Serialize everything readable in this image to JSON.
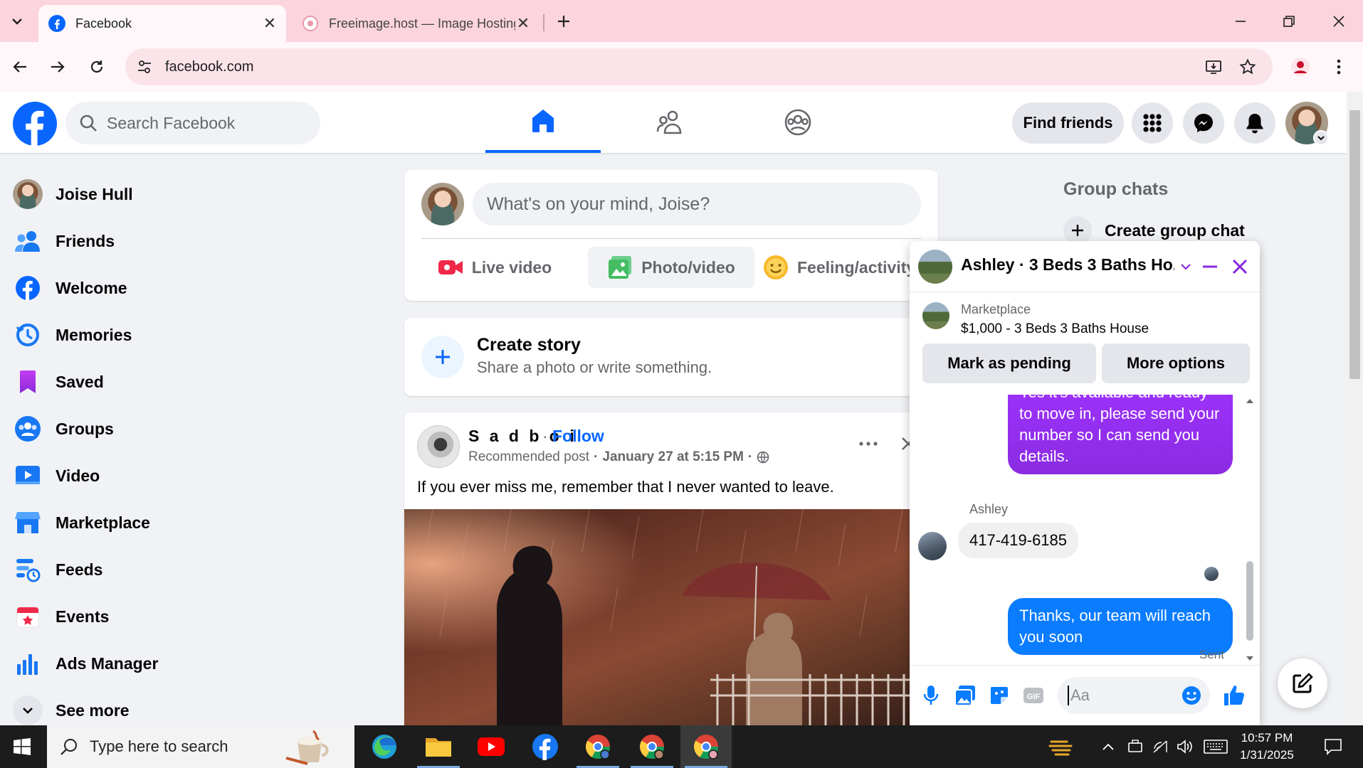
{
  "browser": {
    "tabs": [
      {
        "title": "Facebook",
        "active": true
      },
      {
        "title": "Freeimage.host — Image Hosting",
        "active": false
      }
    ],
    "url": "facebook.com"
  },
  "fb": {
    "search_placeholder": "Search Facebook",
    "find_friends": "Find friends",
    "composer_placeholder": "What's on your mind, Joise?",
    "composer_actions": {
      "live": "Live video",
      "photo": "Photo/video",
      "feeling": "Feeling/activity"
    },
    "story": {
      "title": "Create story",
      "subtitle": "Share a photo or write something."
    }
  },
  "sidebar": {
    "items": [
      {
        "label": "Joise Hull",
        "icon": "profile-avatar"
      },
      {
        "label": "Friends",
        "icon": "friends-icon"
      },
      {
        "label": "Welcome",
        "icon": "facebook-icon"
      },
      {
        "label": "Memories",
        "icon": "clock-icon"
      },
      {
        "label": "Saved",
        "icon": "bookmark-icon"
      },
      {
        "label": "Groups",
        "icon": "groups-icon"
      },
      {
        "label": "Video",
        "icon": "video-icon"
      },
      {
        "label": "Marketplace",
        "icon": "store-icon"
      },
      {
        "label": "Feeds",
        "icon": "feeds-icon"
      },
      {
        "label": "Events",
        "icon": "calendar-icon"
      },
      {
        "label": "Ads Manager",
        "icon": "bar-chart-icon"
      },
      {
        "label": "See more",
        "icon": "chevron-down-icon"
      }
    ]
  },
  "post": {
    "author": "S a d b o i",
    "follow": "Follow",
    "kind": "Recommended post",
    "time": "January 27 at 5:15 PM",
    "text": "If you ever miss me, remember that I never wanted to leave."
  },
  "right": {
    "group_chats": "Group chats",
    "create_group_chat": "Create group chat"
  },
  "chat": {
    "title": "Ashley · 3 Beds 3 Baths Ho...",
    "marketplace_label": "Marketplace",
    "listing": "$1,000 - 3 Beds 3 Baths House",
    "mark_pending": "Mark as pending",
    "more_options": "More options",
    "msg_out_1": "Yes it's available and ready to move in, please send your number so I can send you details.",
    "sender": "Ashley",
    "msg_in_1": "417-419-6185",
    "msg_out_2": "Thanks, our team will reach you soon",
    "status": "Sent",
    "input_placeholder": "Aa"
  },
  "taskbar": {
    "search_placeholder": "Type here to search",
    "time": "10:57 PM",
    "date": "1/31/2025"
  },
  "colors": {
    "fb_blue": "#0866ff",
    "chrome_pink": "#fcd4dd",
    "bubble_purple": "#9b30ff",
    "bubble_blue": "#0a7cff"
  }
}
